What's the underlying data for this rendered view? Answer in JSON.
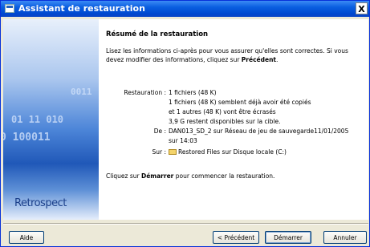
{
  "window": {
    "title": "Assistant de restauration",
    "close_glyph": "X"
  },
  "banner": {
    "binary_1": "0011",
    "binary_2": "01 11 010",
    "binary_3": "0 100011",
    "logo": "Retrospect"
  },
  "content": {
    "heading": "Résumé de la restauration",
    "intro_1": "Lisez les informations ci-après pour vous assurer qu'elles sont correctes. Si vous devez modifier des informations, cliquez sur ",
    "intro_bold": "Précédent",
    "intro_2": ".",
    "restore_label": "Restauration :",
    "restore_lines": [
      "1 fichiers (48 K)",
      "1 fichiers (48 K) semblent déjà avoir été copiés",
      "et 1 autres (48 K) vont être écrasés",
      "3,9 G restent disponibles sur la cible."
    ],
    "from_label": "De :",
    "from_lines": [
      "DAN013_SD_2 sur Réseau de jeu de sauvegarde11/01/2005",
      "sur 14:03"
    ],
    "to_label": "Sur :",
    "to_value": "Restored Files sur Disque locale (C:)",
    "note_1": "Cliquez sur ",
    "note_bold": "Démarrer",
    "note_2": " pour commencer la restauration."
  },
  "buttons": {
    "help": "Aide",
    "back": "< Précédent",
    "start": "Démarrer",
    "cancel": "Annuler"
  },
  "icons": {
    "window": "window-icon",
    "close": "close-icon",
    "folder": "folder-icon"
  },
  "colors": {
    "titlebar": "#0a5ee0",
    "button_border": "#003c74",
    "dialog_bg": "#ece9d8"
  }
}
